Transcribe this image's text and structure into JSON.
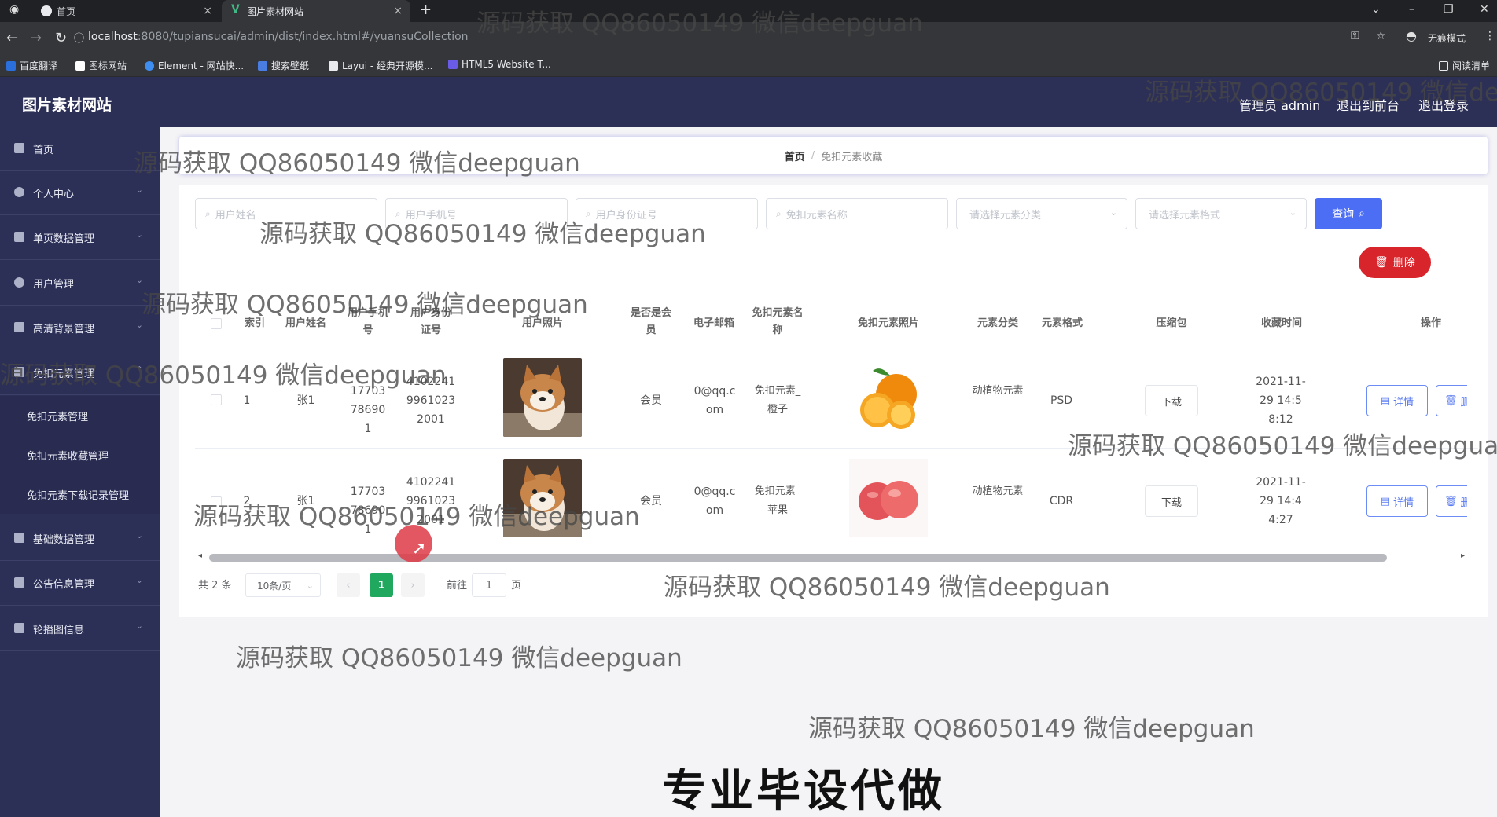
{
  "browser": {
    "tabs": [
      {
        "label": "首页"
      },
      {
        "label": "图片素材网站"
      }
    ],
    "new_tab": "+",
    "url_host": "localhost",
    "url_rest": ":8080/tupiansucai/admin/dist/index.html#/yuansuCollection",
    "profile_label": "无痕模式",
    "reading_list": "阅读清单",
    "bookmarks": [
      {
        "label": "百度翻译",
        "color": "#2a6fdb"
      },
      {
        "label": "图标网站",
        "color": "#ffffff"
      },
      {
        "label": "Element - 网站快...",
        "color": "#3d8ef0"
      },
      {
        "label": "搜索壁纸",
        "color": "#4a7de2"
      },
      {
        "label": "Layui - 经典开源模...",
        "color": "#e8eaed"
      },
      {
        "label": "HTML5 Website T...",
        "color": "#6b5ce7"
      }
    ]
  },
  "header": {
    "site_title": "图片素材网站",
    "admin_label": "管理员 admin",
    "to_front": "退出到前台",
    "logout": "退出登录"
  },
  "sidebar": {
    "items": [
      {
        "label": "首页",
        "icon": "home-icon"
      },
      {
        "label": "个人中心",
        "icon": "user-icon"
      },
      {
        "label": "单页数据管理",
        "icon": "list-icon"
      },
      {
        "label": "用户管理",
        "icon": "clock-icon"
      },
      {
        "label": "高清背景管理",
        "icon": "image-icon"
      },
      {
        "label": "免扣元素管理",
        "icon": "image-icon"
      }
    ],
    "submenu": [
      {
        "label": "免扣元素管理"
      },
      {
        "label": "免扣元素收藏管理"
      },
      {
        "label": "免扣元素下载记录管理"
      }
    ],
    "items_after": [
      {
        "label": "基础数据管理",
        "icon": "data-icon"
      },
      {
        "label": "公告信息管理",
        "icon": "notice-icon"
      },
      {
        "label": "轮播图信息",
        "icon": "carousel-icon"
      }
    ]
  },
  "breadcrumb": {
    "home": "首页",
    "separator": "/",
    "current": "免扣元素收藏"
  },
  "search": {
    "username_placeholder": "用户姓名",
    "phone_placeholder": "用户手机号",
    "idcard_placeholder": "用户身份证号",
    "element_name_placeholder": "免扣元素名称",
    "category_placeholder": "请选择元素分类",
    "format_placeholder": "请选择元素格式",
    "query_label": "查询",
    "delete_label": "删除"
  },
  "table": {
    "headers": {
      "index": "索引",
      "name": "用户姓名",
      "phone": "用户手机号",
      "idcard": "用户身份证号",
      "photo": "用户照片",
      "member": "是否是会员",
      "email": "电子邮箱",
      "element_name": "免扣元素名称",
      "element_photo": "免扣元素照片",
      "category": "元素分类",
      "format": "元素格式",
      "zip": "压缩包",
      "time": "收藏时间",
      "actions": "操作"
    },
    "rows": [
      {
        "index": "1",
        "name": "张1",
        "phone": "17703786901",
        "idcard": "410224199610232001",
        "member": "会员",
        "email": "0@qq.com",
        "element_name": "免扣元素_橙子",
        "fruit": "orange",
        "category": "动植物元素",
        "format": "PSD",
        "download": "下载",
        "time": "2021-11-29 14:58:12",
        "detail": "详情",
        "delete": "删除"
      },
      {
        "index": "2",
        "name": "张1",
        "phone": "17703786901",
        "idcard": "410224199610232001",
        "member": "会员",
        "email": "0@qq.com",
        "element_name": "免扣元素_苹果",
        "fruit": "apple",
        "category": "动植物元素",
        "format": "CDR",
        "download": "下载",
        "time": "2021-11-29 14:44:27",
        "detail": "详情",
        "delete": "删除"
      }
    ]
  },
  "pagination": {
    "total": "共 2 条",
    "page_size": "10条/页",
    "current_page": "1",
    "goto_label": "前往",
    "goto_value": "1",
    "page_unit": "页"
  },
  "overlay": {
    "watermarks": [
      "源码获取 QQ86050149 微信deepguan",
      "源码获取 QQ86050149 微信deepguan",
      "源码获取 QQ86050149 微信deepguan",
      "源码获取 QQ86050149 微信deepguan",
      "源码获取 QQ86050149 微信deepguan",
      "源码获取 QQ86050149 微信deepguan",
      "源码获取 QQ86050149 微信deepguan",
      "源码获取 QQ86050149 微信deepguan",
      "源码获取 QQ86050149 微信deepguan",
      "源码获取 QQ86050149 微信deepguan",
      "源码获取 QQ86050149 微信deepguan"
    ],
    "banner": "专业毕设代做"
  },
  "colors": {
    "sidebar_bg": "#2d3056",
    "query_btn": "#4c6ef5",
    "delete_btn": "#d8242b",
    "active_page": "#21a85f"
  }
}
